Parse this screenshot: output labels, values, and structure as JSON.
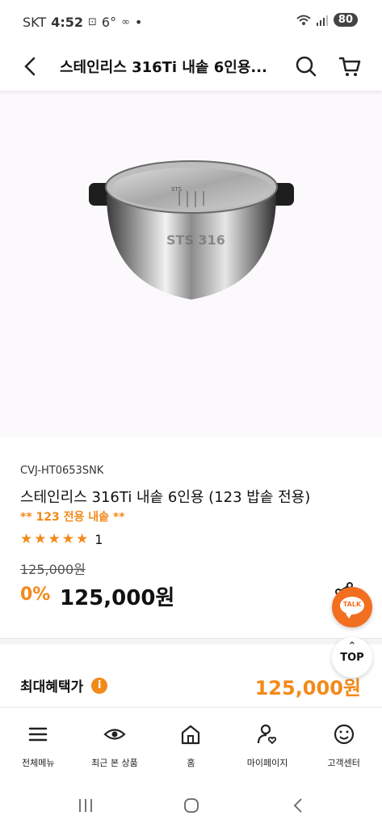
{
  "status_bar": {
    "carrier": "SKT",
    "time": "4:52",
    "extra": "6°",
    "dot": "•",
    "battery": "80"
  },
  "header": {
    "title": "스테인리스 316Ti 내솥 6인용..."
  },
  "product": {
    "model": "CVJ-HT0653SNK",
    "name": "스테인리스 316Ti 내솥 6인용 (123 밥솥 전용)",
    "promo": "** 123 전용 내솥 **",
    "rating_stars": 5,
    "review_count": "1",
    "original_price": "125,000원",
    "discount": "0%",
    "sale_price": "125,000원",
    "pot_engraving": "STS 316"
  },
  "benefit": {
    "label": "최대혜택가",
    "info_icon": "i",
    "price": "125,000원"
  },
  "floating": {
    "talk_label": "TALK",
    "top_label": "TOP"
  },
  "bottom_nav": {
    "items": [
      {
        "label": "전체메뉴",
        "icon": "menu-icon"
      },
      {
        "label": "최근 본 상품",
        "icon": "eye-icon"
      },
      {
        "label": "홈",
        "icon": "home-icon"
      },
      {
        "label": "마이페이지",
        "icon": "user-heart-icon"
      },
      {
        "label": "고객센터",
        "icon": "smile-icon"
      }
    ]
  },
  "colors": {
    "accent": "#f28a1a",
    "talk": "#f26f1f",
    "image_bg": "#fcf9fd"
  }
}
